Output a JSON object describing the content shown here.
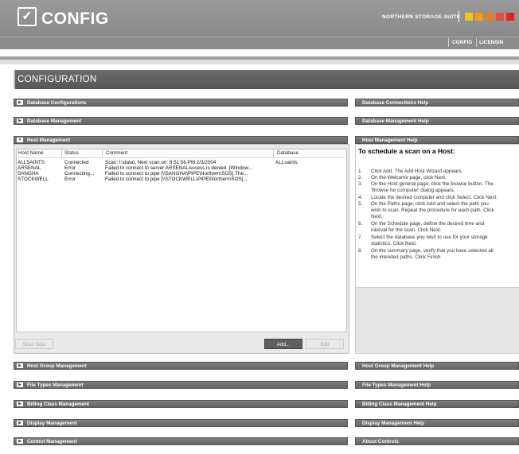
{
  "header": {
    "logo_glyph": "✓",
    "title": "CONFIG",
    "suite": "NORTHERN STORAGE SUITE",
    "suite_colors": [
      "#f5c518",
      "#f39c12",
      "#e67e22",
      "#e74c3c",
      "#e32222"
    ]
  },
  "nav": {
    "config": "CONFIG",
    "licensing": "LICENSIN"
  },
  "page_title": "CONFIGURATION",
  "sections": {
    "db_config": "Database Configurations",
    "db_mgmt": "Database Management",
    "host_mgmt": "Host Management",
    "host_group": "Host Group Management",
    "file_types": "File Types Management",
    "billing": "Billing Class Management",
    "display": "Display Management",
    "control": "Control Management"
  },
  "help_bars": {
    "db_conn": "Database Connections Help",
    "db_mgmt": "Database Management Help",
    "host_mgmt": "Host Management Help",
    "host_group": "Host Group Management Help",
    "file_types": "File Types Management Help",
    "billing": "Billing Class Management Help",
    "display": "Display Management Help",
    "about": "About Controls"
  },
  "arrows": {
    "collapsed": "▶",
    "expanded": "▼"
  },
  "host_table": {
    "headers": {
      "name": "Host Name",
      "status": "Status",
      "comment": "Comment",
      "database": "Database"
    },
    "rows": [
      {
        "name": "ALLSAINTS",
        "status": "Connected",
        "comment": "Scan: I:\\data\\, Next scan on: 8:51:56 PM 2/3/2004",
        "database": "ALLsaints"
      },
      {
        "name": "ARSENAL",
        "status": "Error",
        "comment": "Failed to connect to server ARSENALAccess is denied. [Window...",
        "database": ""
      },
      {
        "name": "SANGHA",
        "status": "Connecting...",
        "comment": "Failed to connect to pipe [\\\\SANGHA\\PIPE\\Northern\\SOS].The...",
        "database": ""
      },
      {
        "name": "STOCKWELL",
        "status": "Error",
        "comment": "Failed to connect to pipe [\\\\STOCKWELL\\PIPE\\Northern\\SOS]....",
        "database": ""
      }
    ]
  },
  "buttons": {
    "scan_now": "Scan Now",
    "add": "Add...",
    "edit": "Edit"
  },
  "help": {
    "title": "To schedule a scan on a Host:",
    "steps": [
      {
        "n": "1.",
        "lines": [
          "Click Add. The Add Host Wizard appears."
        ]
      },
      {
        "n": "2.",
        "lines": [
          "On the Welcome page, click Next."
        ]
      },
      {
        "n": "3.",
        "lines": [
          "On the Host general page, click the browse button. The",
          "'Browse for computer' dialog appears."
        ]
      },
      {
        "n": "4.",
        "lines": [
          "Locate the desired computer and click Select. Click Next."
        ]
      },
      {
        "n": "5.",
        "lines": [
          "On the Paths page, click Add and select the path you",
          "wish to scan. Repeat the procedure for each path. Click",
          "Next."
        ]
      },
      {
        "n": "6.",
        "lines": [
          "On the Schedule page, define the desired time and",
          "interval for the scan. Click Next."
        ]
      },
      {
        "n": "7.",
        "lines": [
          "Select the database you wish to use for your storage",
          "statistics. Click Next."
        ]
      },
      {
        "n": "8.",
        "lines": [
          "On the summary page, verify that you have selected all",
          "the intended paths. Click Finish"
        ]
      }
    ]
  }
}
